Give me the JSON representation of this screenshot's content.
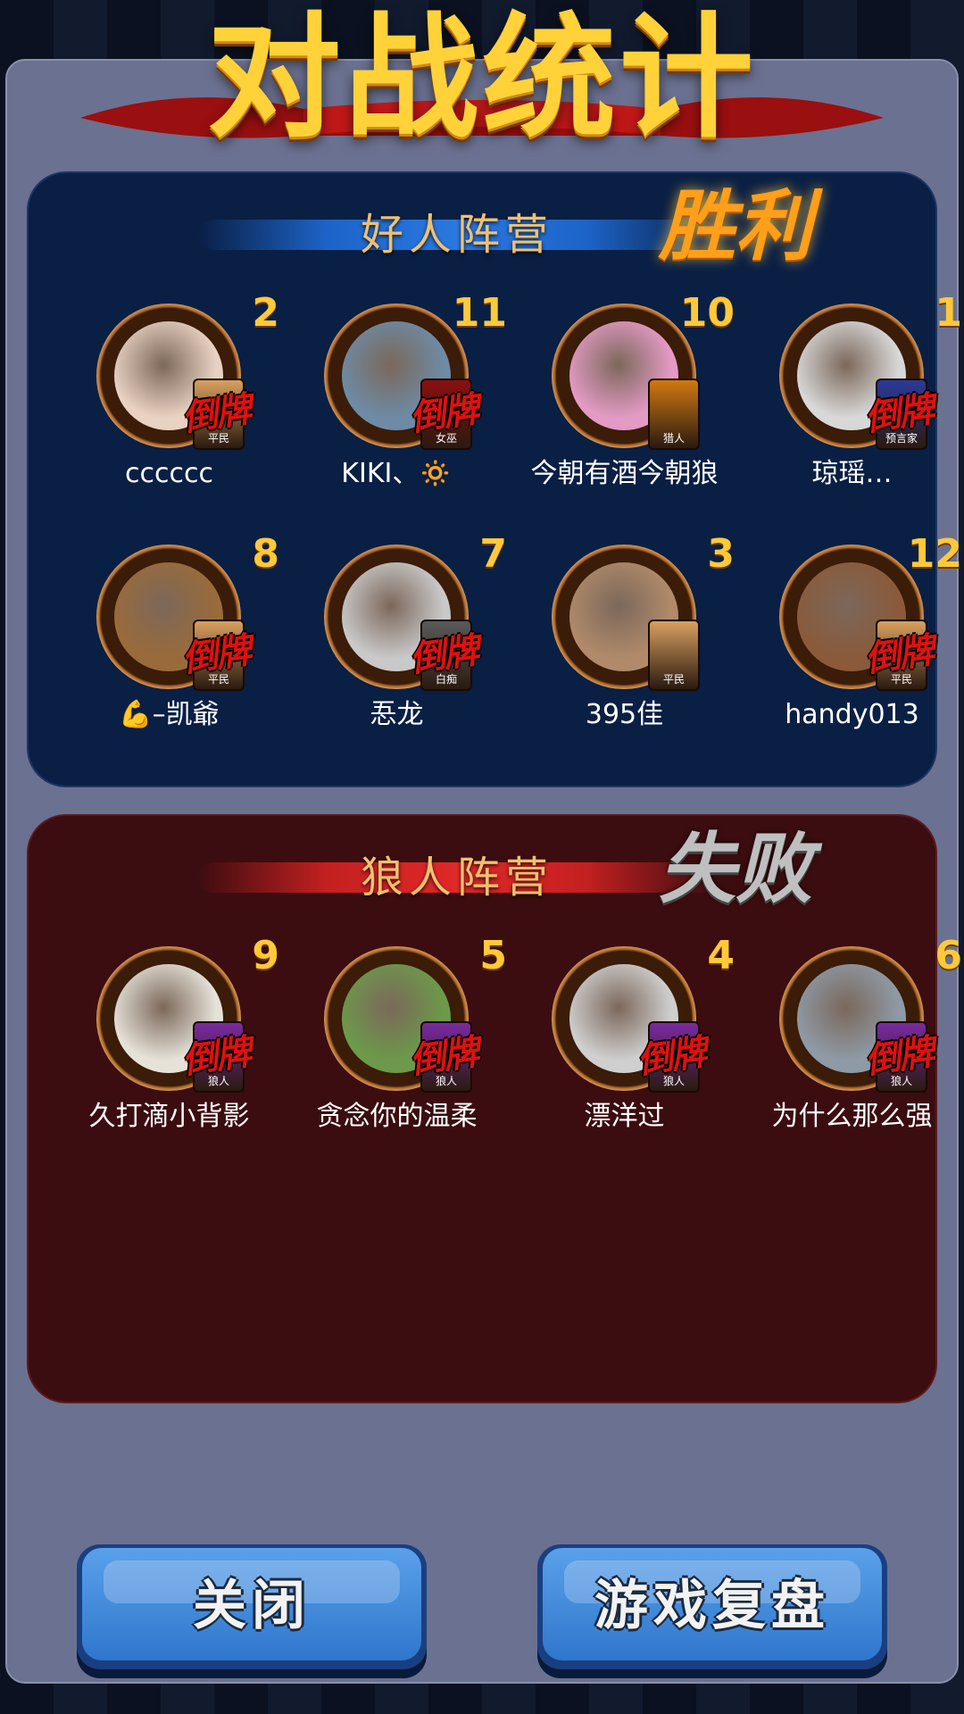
{
  "header": {
    "title": "对战统计"
  },
  "good_camp": {
    "title": "好人阵营",
    "result": "胜利",
    "players": [
      {
        "seat": "2",
        "name": "cccccc",
        "role": "平民",
        "dead_stamp": "倒牌",
        "avatar_color": "#e9d2c2"
      },
      {
        "seat": "11",
        "name": "KIKI、🔅",
        "role": "女巫",
        "dead_stamp": "倒牌",
        "avatar_color": "#6d8ba5"
      },
      {
        "seat": "10",
        "name": "今朝有酒今朝狼",
        "role": "猎人",
        "dead_stamp": "",
        "avatar_color": "#e39ac4"
      },
      {
        "seat": "1",
        "name": "琼瑶…",
        "role": "预言家",
        "dead_stamp": "倒牌",
        "avatar_color": "#d8d8d8"
      },
      {
        "seat": "8",
        "name": "💪–凯爺",
        "role": "平民",
        "dead_stamp": "倒牌",
        "avatar_color": "#9a6b3a"
      },
      {
        "seat": "7",
        "name": "忢龙",
        "role": "白痴",
        "dead_stamp": "倒牌",
        "avatar_color": "#c9c9c9"
      },
      {
        "seat": "3",
        "name": "395佳",
        "role": "平民",
        "dead_stamp": "",
        "avatar_color": "#b08a6a"
      },
      {
        "seat": "12",
        "name": "handy013",
        "role": "平民",
        "dead_stamp": "倒牌",
        "avatar_color": "#8a5a3a"
      }
    ]
  },
  "wolf_camp": {
    "title": "狼人阵营",
    "result": "失败",
    "players": [
      {
        "seat": "9",
        "name": "久打滴小背影",
        "role": "狼人",
        "dead_stamp": "倒牌",
        "avatar_color": "#e6e2d8"
      },
      {
        "seat": "5",
        "name": "贪念你的温柔",
        "role": "狼人",
        "dead_stamp": "倒牌",
        "avatar_color": "#6c9a4a"
      },
      {
        "seat": "4",
        "name": "漂洋过",
        "role": "狼人",
        "dead_stamp": "倒牌",
        "avatar_color": "#cfcfcf"
      },
      {
        "seat": "6",
        "name": "为什么那么强",
        "role": "狼人",
        "dead_stamp": "倒牌",
        "avatar_color": "#8e9aa6"
      }
    ]
  },
  "buttons": {
    "close": "关闭",
    "replay": "游戏复盘"
  },
  "colors": {
    "role_civilian": "#d8a060",
    "role_witch": "#8a1010",
    "role_hunter": "#d07a10",
    "role_seer": "#2a3a9a",
    "role_idiot": "#5a5a5a",
    "role_wolf": "#7a2aa0"
  }
}
